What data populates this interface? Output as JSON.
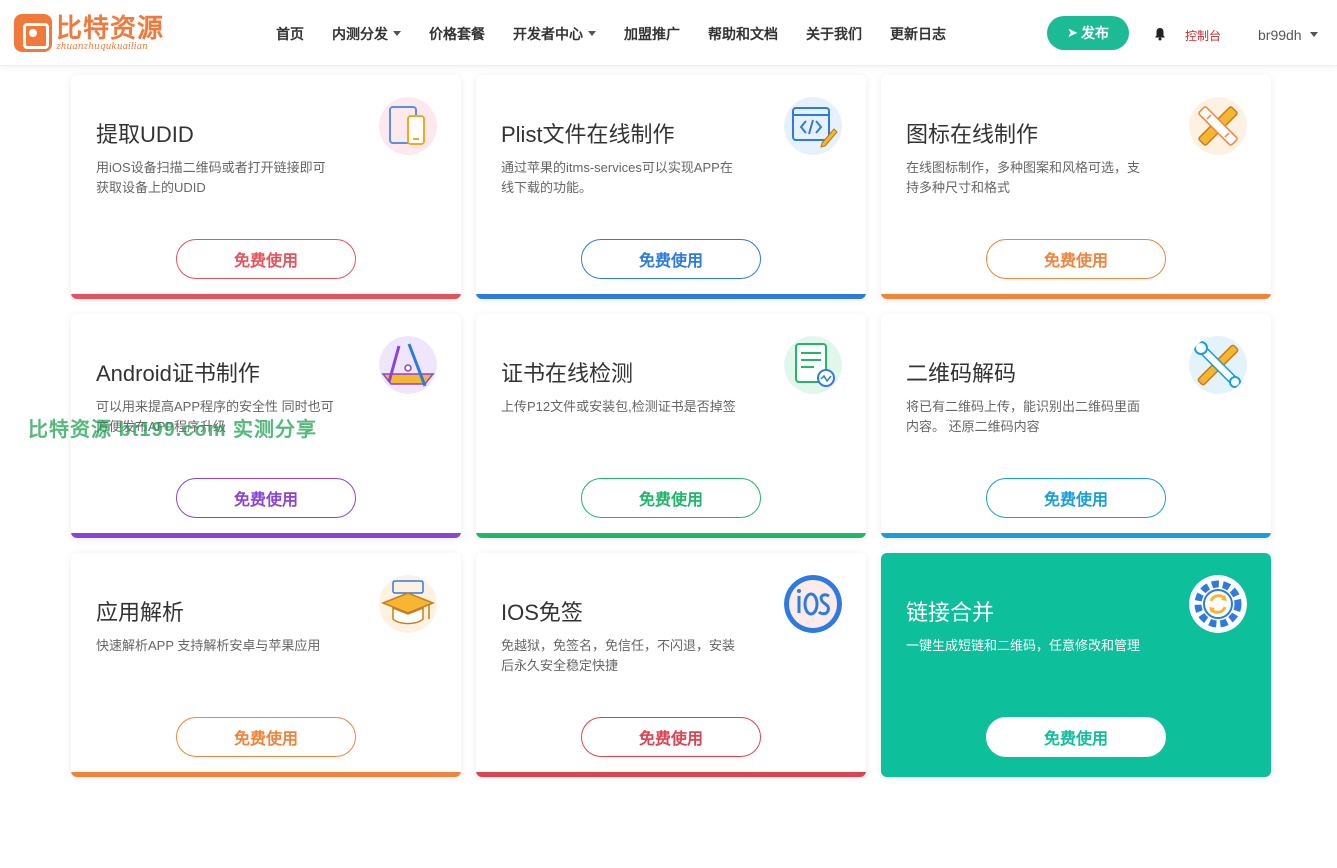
{
  "brand": {
    "title": "比特资源",
    "subtitle": "zhuanzhuqukuailian"
  },
  "nav": [
    {
      "label": "首页"
    },
    {
      "label": "内测分发"
    },
    {
      "label": "价格套餐"
    },
    {
      "label": "开发者中心"
    },
    {
      "label": "加盟推广"
    },
    {
      "label": "帮助和文档"
    },
    {
      "label": "关于我们"
    },
    {
      "label": "更新日志"
    }
  ],
  "header": {
    "publish_label": "发布",
    "console_label": "控制台",
    "username": "br99dh"
  },
  "colors": {
    "accent": "#1dba96",
    "brand": "#f1793b",
    "featured": "#0dbf9b"
  },
  "cards": [
    {
      "title": "提取UDID",
      "desc": "用iOS设备扫描二维码或者打开链接即可获取设备上的UDID",
      "button": "免费使用",
      "color": "#e5545d",
      "icon": "tablet-phone-icon"
    },
    {
      "title": "Plist文件在线制作",
      "desc": "通过苹果的itms-services可以实现APP在线下载的功能。",
      "button": "免费使用",
      "color": "#2d7be0",
      "icon": "code-file-icon"
    },
    {
      "title": "图标在线制作",
      "desc": "在线图标制作，多种图案和风格可选，支持多种尺寸和格式",
      "button": "免费使用",
      "color": "#f0843a",
      "icon": "pencil-ruler-icon"
    },
    {
      "title": "Android证书制作",
      "desc": "可以用来提高APP程序的安全性 同时也可方便发布APP程序升级",
      "button": "免费使用",
      "color": "#8a44d8",
      "icon": "drafting-tools-icon"
    },
    {
      "title": "证书在线检测",
      "desc": "上传P12文件或安装包,检测证书是否掉签",
      "button": "免费使用",
      "color": "#21b66a",
      "icon": "certificate-doc-icon"
    },
    {
      "title": "二维码解码",
      "desc": "将已有二维码上传，能识别出二维码里面内容。 还原二维码内容",
      "button": "免费使用",
      "color": "#1a9de0",
      "icon": "wrench-hammer-icon"
    },
    {
      "title": "应用解析",
      "desc": "快速解析APP 支持解析安卓与苹果应用",
      "button": "免费使用",
      "color": "#f0843a",
      "icon": "graduation-cap-icon"
    },
    {
      "title": "IOS免签",
      "desc": "免越狱，免签名，免信任，不闪退，安装后永久安全稳定快捷",
      "button": "免费使用",
      "color": "#e04350",
      "icon": "ios-badge-icon"
    },
    {
      "title": "链接合并",
      "desc": "一键生成短链和二维码，任意修改和管理",
      "button": "免费使用",
      "color": "#0dbf9b",
      "icon": "gear-sync-icon"
    }
  ],
  "watermark": "比特资源 bt199.com  实测分享"
}
